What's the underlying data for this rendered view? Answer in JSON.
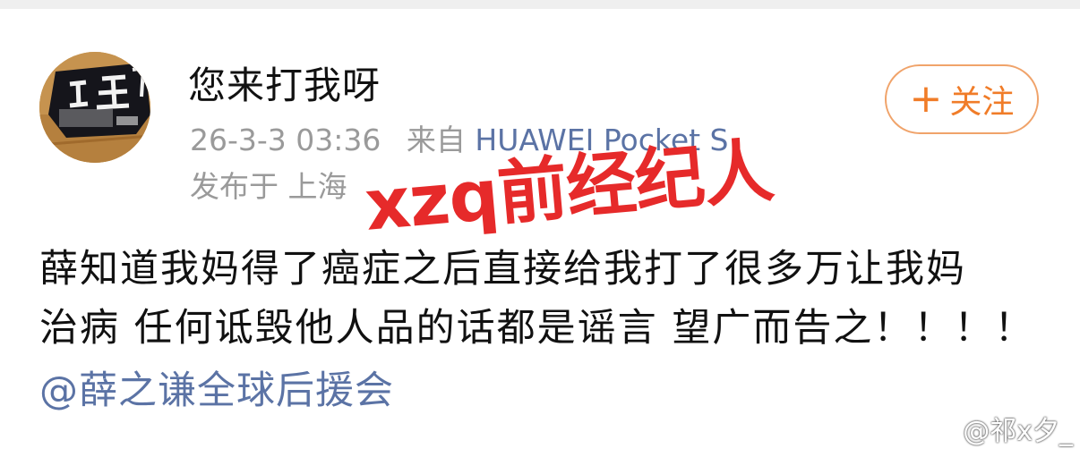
{
  "post": {
    "username": "您来打我呀",
    "timestamp": "26-3-3 03:36",
    "from_prefix": "来自",
    "source": "HUAWEI Pocket S",
    "location": "发布于 上海",
    "follow_plus": "+",
    "follow_label": "关注",
    "body_lines": [
      "薛知道我妈得了癌症之后直接给我打了很多万让我妈",
      "治病 任何诋毁他人品的话都是谣言 望广而告之！！！！"
    ],
    "mention": "@薛之谦全球后援会"
  },
  "overlay": {
    "text": "xzq前经纪人",
    "color": "#e62a2a"
  },
  "watermark": {
    "text": "@祁x夕_"
  },
  "colors": {
    "accent": "#f07c28",
    "link": "#5b73a5",
    "meta": "#9a9a9a"
  },
  "icons": {
    "avatar": "avatar-photo",
    "watermark": "weibo-icon"
  }
}
